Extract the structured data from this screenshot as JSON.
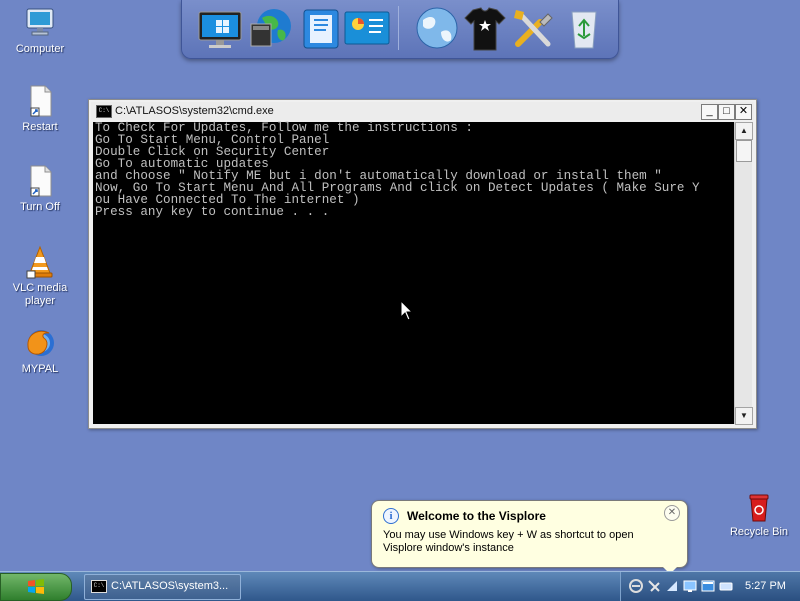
{
  "desktop": {
    "icons": [
      {
        "label": "Computer"
      },
      {
        "label": "Restart"
      },
      {
        "label": "Turn Off"
      },
      {
        "label": "VLC media player"
      },
      {
        "label": "MYPAL"
      },
      {
        "label": "Recycle Bin"
      }
    ]
  },
  "dock": {
    "items": [
      {
        "icon": "monitor-icon"
      },
      {
        "icon": "globe-icon"
      },
      {
        "icon": "documents-icon"
      },
      {
        "icon": "control-panel-icon"
      },
      {
        "icon": "world-globe-icon"
      },
      {
        "icon": "tshirt-icon"
      },
      {
        "icon": "tools-icon"
      },
      {
        "icon": "recycle-bin-icon"
      }
    ]
  },
  "cmd_window": {
    "title": "C:\\ATLASOS\\system32\\cmd.exe",
    "icon_text": "C:\\",
    "lines": [
      "To Check For Updates, Follow me the instructions :",
      "Go To Start Menu, Control Panel",
      "Double Click on Security Center",
      "Go To automatic updates",
      "and choose \" Notify ME but i don't automatically download or install them \"",
      "Now, Go To Start Menu And All Programs And click on Detect Updates ( Make Sure Y",
      "ou Have Connected To The internet )",
      "Press any key to continue . . ."
    ],
    "buttons": {
      "minimize": "_",
      "maximize": "□",
      "close": "✕"
    },
    "scroll": {
      "up": "▲",
      "down": "▼"
    }
  },
  "balloon": {
    "title": "Welcome to the Visplore",
    "message": "You may use Windows key + W as shortcut to open Visplore window's instance",
    "close": "✕",
    "info": "i"
  },
  "taskbar": {
    "task_label": "C:\\ATLASOS\\system3...",
    "task_icon_text": "C:\\",
    "clock": "5:27 PM",
    "tray_icons": [
      "network-icon",
      "antivirus-icon",
      "update-icon",
      "monitor-tray-icon",
      "window-tray-icon",
      "keyboard-icon"
    ]
  },
  "colors": {
    "desktop": "#6f86c6",
    "console_bg": "#000000",
    "console_text": "#c0c0c0",
    "balloon_bg": "#ffffe1"
  }
}
